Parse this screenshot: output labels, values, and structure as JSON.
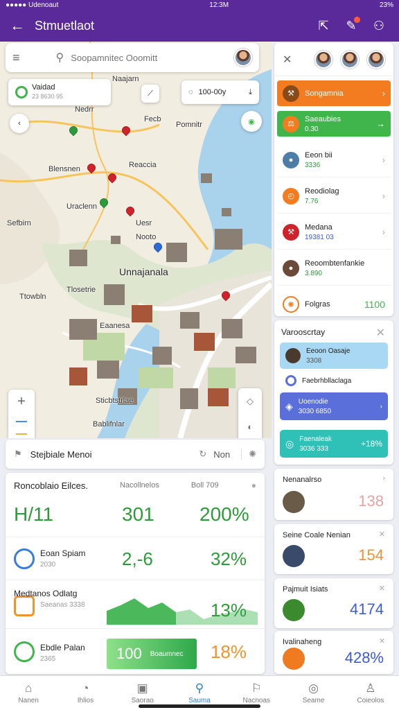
{
  "status": {
    "carrier": "●●●●● Udenoaut",
    "time": "12:3M",
    "battery": "23%"
  },
  "appbar": {
    "title": "Stmuetlaot"
  },
  "map": {
    "search_placeholder": "Soopamnitec Ooomitt",
    "place_card": {
      "title": "Vaidad",
      "subtitle": "23 8630 95"
    },
    "measure_card": "100-00y",
    "labels": [
      {
        "text": "Naajarn"
      },
      {
        "text": "Nedrr"
      },
      {
        "text": "Fecb"
      },
      {
        "text": "Pomnitr"
      },
      {
        "text": "Blensnen",
        "big": false
      },
      {
        "text": "Reaccia"
      },
      {
        "text": "Sefbirn"
      },
      {
        "text": "Uesr"
      },
      {
        "text": "Uraclenn"
      },
      {
        "text": "Nooto"
      },
      {
        "text": "Unnajanala",
        "big": true
      },
      {
        "text": "Tlosetrie"
      },
      {
        "text": "Ttowbln"
      },
      {
        "text": "Eaanesa"
      },
      {
        "text": "Sticbtstrlae"
      },
      {
        "text": "Bablifnlar"
      }
    ]
  },
  "stepbar": {
    "label": "Stejbiale Menoi",
    "action": "Non"
  },
  "stats": {
    "header": {
      "title": "Roncoblaio Eilces.",
      "col1": "Nacollnelos",
      "col2": "Boll 709"
    },
    "big": [
      "H/11",
      "301",
      "200%"
    ],
    "rows": [
      {
        "name": "Eoan Spiam",
        "sub": "2030",
        "v1": "2,-6",
        "v2": "32%",
        "v2_color": "#2e9b3a"
      },
      {
        "name": "Medtanos Odlatg",
        "sub": "Saeanas 3338",
        "v1": "",
        "v2": "13%",
        "v2_color": "#2e9b3a"
      },
      {
        "name": "Ebdle Palan",
        "sub": "2365",
        "v1": "100",
        "v1_extra": "Boaumnec",
        "v2": "18%",
        "v2_color": "#f0932b"
      }
    ]
  },
  "panel": {
    "rows": [
      {
        "name": "Songamnia",
        "sub": "",
        "bg": "#f37b20",
        "color": "#fff",
        "icon": "🔨"
      },
      {
        "name": "Saeaubies",
        "sub": "0.30",
        "bg": "#3fb54c",
        "color": "#fff",
        "icon": "⚖"
      },
      {
        "name": "Eeon bii",
        "sub": "3336",
        "bg": "#fff",
        "color": "#222",
        "sub_color": "#2e9b3a",
        "icon": "👥"
      },
      {
        "name": "Reodiolag",
        "sub": "7.76",
        "bg": "#fff",
        "color": "#222",
        "sub_color": "#2e9b3a",
        "icon": "⏱"
      },
      {
        "name": "Medana",
        "sub": "19381 03",
        "bg": "#fff",
        "color": "#222",
        "sub_color": "#3b5bdb",
        "icon": "🔧"
      },
      {
        "name": "Reoombtenfankie",
        "sub": "3.890",
        "bg": "#fff",
        "color": "#222",
        "sub_color": "#2e9b3a",
        "icon": "👤"
      },
      {
        "name": "Folgras",
        "sub": "",
        "value": "1100",
        "bg": "#fff",
        "color": "#222",
        "icon": "⚙"
      }
    ]
  },
  "vpanel": {
    "title": "Varooscrtay",
    "cards": [
      {
        "name": "Eeoon Oasaje",
        "sub": "3308",
        "bg": "#a8d8f3",
        "color": "#222"
      },
      {
        "name": "Faebrhbllaclaga",
        "sub": "",
        "bg": "#fff",
        "color": "#444"
      },
      {
        "name": "Uoenodie",
        "sub": "3030 6850",
        "bg": "#5a6fd9",
        "color": "#fff"
      },
      {
        "name": "Faenaleak",
        "sub": "3036 333",
        "value": "+18%",
        "bg": "#2fc0b8",
        "color": "#fff"
      }
    ]
  },
  "rcards": [
    {
      "title": "Nenanalrso",
      "value": "138",
      "value_color": "#e3a4a4"
    },
    {
      "title": "Seine Coale Nenian",
      "value": "154",
      "value_color": "#f0932b"
    },
    {
      "title": "Pajmuit Isiats",
      "value": "4174",
      "value_color": "#3b5bdb"
    },
    {
      "title": "Ivalinaheng",
      "value": "428%",
      "value_color": "#3b5bdb"
    }
  ],
  "nav": [
    {
      "label": "Nanen",
      "icon": "⌂"
    },
    {
      "label": "Ihlios",
      "icon": "◔"
    },
    {
      "label": "Saorao",
      "icon": "▣"
    },
    {
      "label": "Sauma",
      "icon": "⌕",
      "active": true
    },
    {
      "label": "Nacnoas",
      "icon": "⚐"
    },
    {
      "label": "Seame",
      "icon": "◎"
    },
    {
      "label": "Coieolos",
      "icon": "♙"
    }
  ]
}
